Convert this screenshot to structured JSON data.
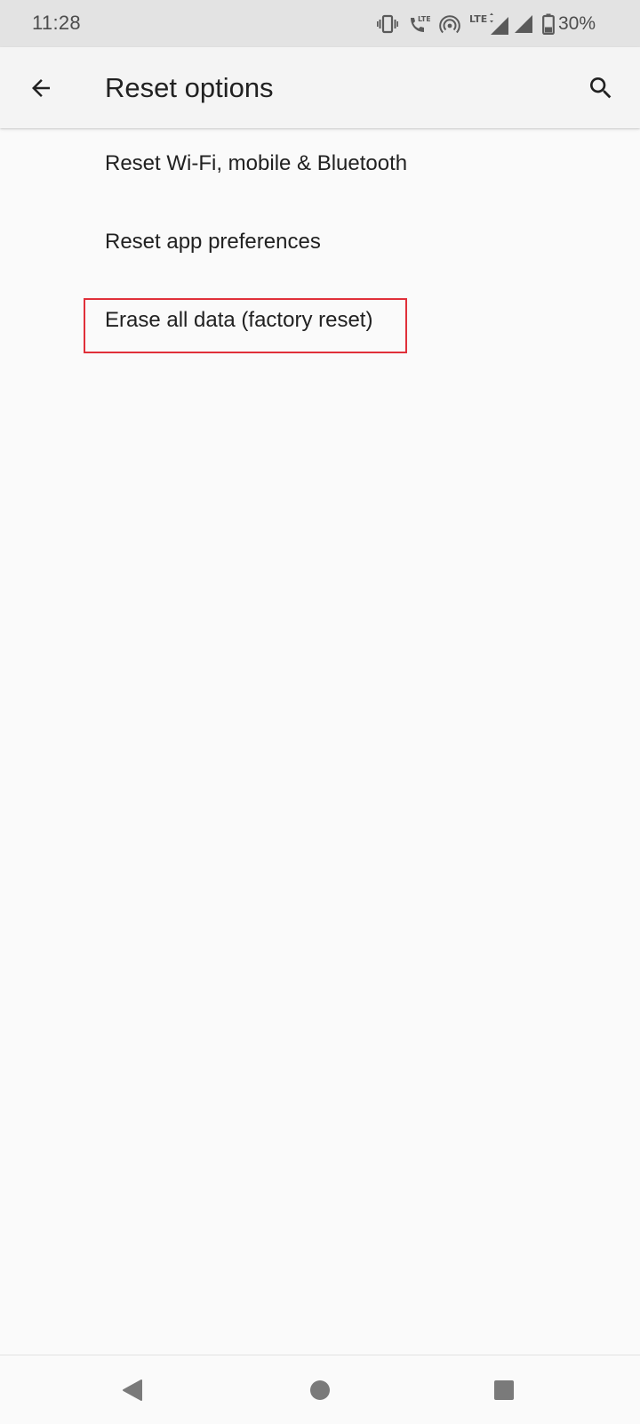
{
  "status_bar": {
    "time": "11:28",
    "battery": "30%",
    "icons": [
      "vibrate-icon",
      "volte-call-icon",
      "hotspot-icon",
      "lte-signal-icon",
      "signal-icon",
      "battery-icon"
    ],
    "lte_label": "LTE"
  },
  "app_bar": {
    "title": "Reset options",
    "back_icon": "arrow-back-icon",
    "search_icon": "search-icon"
  },
  "options": [
    {
      "label": "Reset Wi-Fi, mobile & Bluetooth"
    },
    {
      "label": "Reset app preferences"
    },
    {
      "label": "Erase all data (factory reset)",
      "highlighted": true
    }
  ],
  "nav_bar": {
    "icons": [
      "nav-back-icon",
      "nav-home-icon",
      "nav-recents-icon"
    ]
  },
  "colors": {
    "highlight": "#e0303a",
    "background": "#fafafa",
    "status_bar": "#e3e3e3",
    "text": "#212121"
  }
}
